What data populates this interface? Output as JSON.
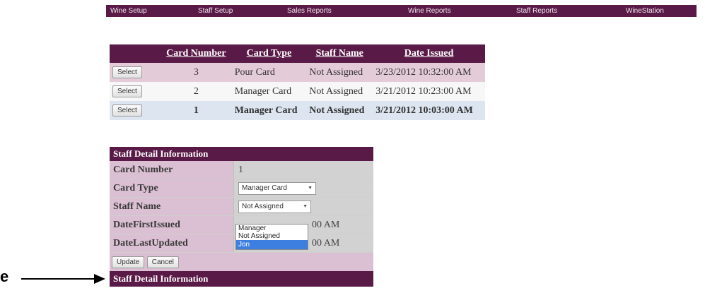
{
  "nav": {
    "items": [
      "Wine Setup",
      "Staff Setup",
      "Sales Reports",
      "Wine Reports",
      "Staff Reports",
      "WineStation"
    ]
  },
  "cards_table": {
    "headers": [
      "Card Number",
      "Card Type",
      "Staff Name",
      "Date Issued"
    ],
    "select_label": "Select",
    "rows": [
      {
        "number": "3",
        "type": "Pour Card",
        "staff": "Not Assigned",
        "date": "3/23/2012 10:32:00 AM"
      },
      {
        "number": "2",
        "type": "Manager Card",
        "staff": "Not Assigned",
        "date": "3/21/2012 10:23:00 AM"
      },
      {
        "number": "1",
        "type": "Manager Card",
        "staff": "Not Assigned",
        "date": "3/21/2012 10:03:00 AM"
      }
    ]
  },
  "detail": {
    "title": "Staff Detail Information",
    "card_number_label": "Card Number",
    "card_number_value": "1",
    "card_type_label": "Card Type",
    "card_type_value": "Manager Card",
    "staff_name_label": "Staff Name",
    "staff_name_value": "Not Assigned",
    "date_first_label": "DateFirstIssued",
    "date_first_value": "00 AM",
    "date_last_label": "DateLastUpdated",
    "date_last_value": "00 AM",
    "update_label": "Update",
    "cancel_label": "Cancel",
    "footer_title": "Staff Detail Information"
  },
  "dropdown": {
    "options": [
      "Manager",
      "Not Assigned",
      "Jon"
    ],
    "selected_index": 2
  },
  "annotation": {
    "letter": "e"
  },
  "colors": {
    "header_purple": "#5a1a47",
    "label_pink": "#dbbfd2",
    "selected_blue": "#3d7fe0"
  }
}
